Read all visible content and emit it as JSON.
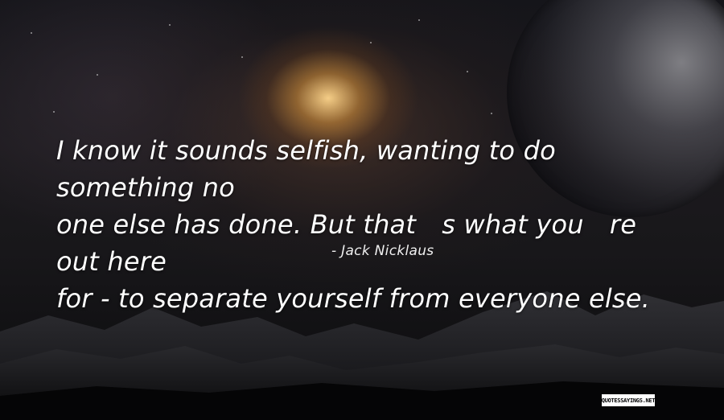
{
  "quote": {
    "text": "I know it sounds selfish, wanting to do something no one else has done. But that s what you re out here for - to separate yourself from everyone else.",
    "line1": "I know it sounds selfish, wanting to do something no",
    "line2": "one else has done. But that s what you re out here",
    "line3": "for - to separate yourself from everyone else."
  },
  "author": "- Jack Nicklaus",
  "watermark": "QUOTESSAYINGS.NET",
  "colors": {
    "text": "#ffffff",
    "sky_glow": "#ffd68c",
    "background": "#15151a"
  }
}
